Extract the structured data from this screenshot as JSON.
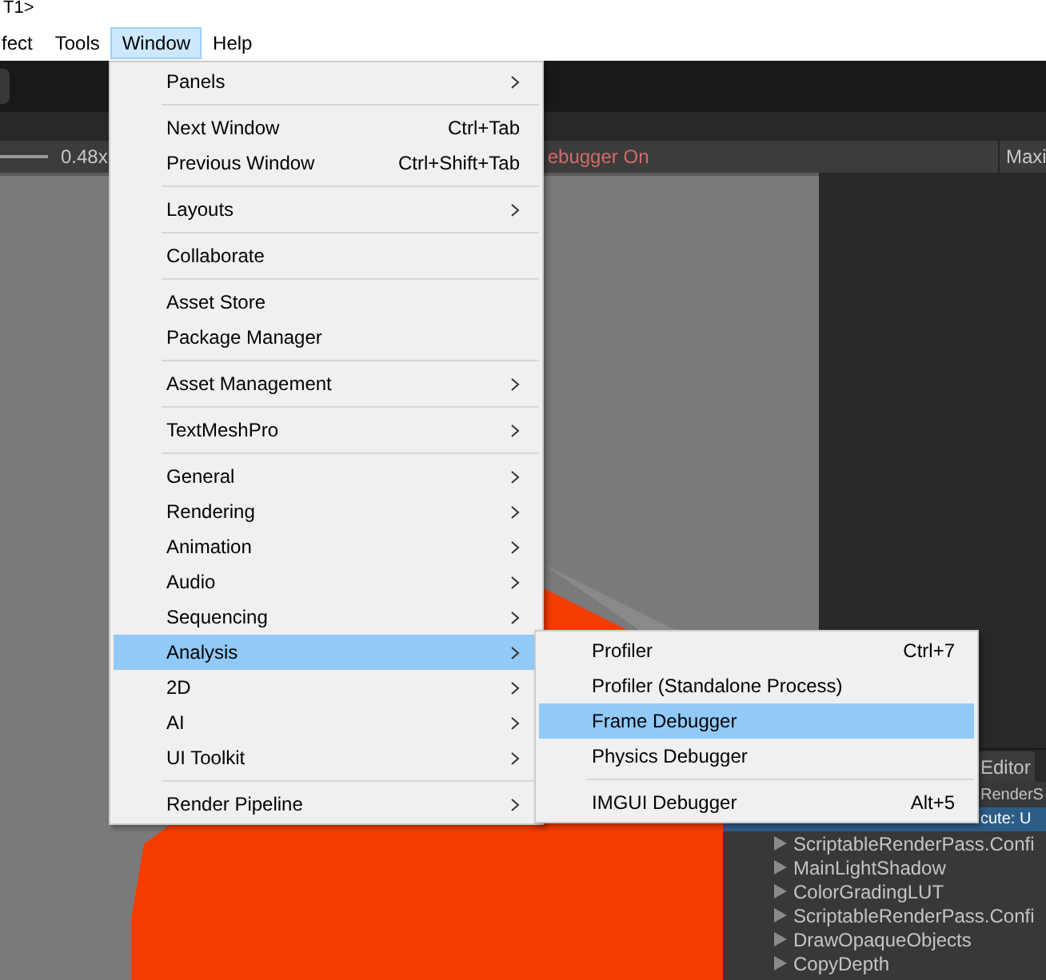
{
  "title_fragment": "T1>",
  "menu_bar": [
    {
      "label": "fect",
      "selected": false
    },
    {
      "label": "Tools",
      "selected": false
    },
    {
      "label": "Window",
      "selected": true
    },
    {
      "label": "Help",
      "selected": false
    }
  ],
  "toolbar": {
    "zoom": "0.48x",
    "status": "ebugger On",
    "button": "Maxi"
  },
  "window_menu": {
    "groups": [
      [
        {
          "label": "Panels",
          "submenu": true,
          "selected": false
        }
      ],
      [
        {
          "label": "Next Window",
          "shortcut": "Ctrl+Tab",
          "submenu": false,
          "selected": false
        },
        {
          "label": "Previous Window",
          "shortcut": "Ctrl+Shift+Tab",
          "submenu": false,
          "selected": false
        }
      ],
      [
        {
          "label": "Layouts",
          "submenu": true,
          "selected": false
        }
      ],
      [
        {
          "label": "Collaborate",
          "submenu": false,
          "selected": false
        }
      ],
      [
        {
          "label": "Asset Store",
          "submenu": false,
          "selected": false
        },
        {
          "label": "Package Manager",
          "submenu": false,
          "selected": false
        }
      ],
      [
        {
          "label": "Asset Management",
          "submenu": true,
          "selected": false
        }
      ],
      [
        {
          "label": "TextMeshPro",
          "submenu": true,
          "selected": false
        }
      ],
      [
        {
          "label": "General",
          "submenu": true,
          "selected": false
        },
        {
          "label": "Rendering",
          "submenu": true,
          "selected": false
        },
        {
          "label": "Animation",
          "submenu": true,
          "selected": false
        },
        {
          "label": "Audio",
          "submenu": true,
          "selected": false
        },
        {
          "label": "Sequencing",
          "submenu": true,
          "selected": false
        },
        {
          "label": "Analysis",
          "submenu": true,
          "selected": true
        },
        {
          "label": "2D",
          "submenu": true,
          "selected": false
        },
        {
          "label": "AI",
          "submenu": true,
          "selected": false
        },
        {
          "label": "UI Toolkit",
          "submenu": true,
          "selected": false
        }
      ],
      [
        {
          "label": "Render Pipeline",
          "submenu": true,
          "selected": false
        }
      ]
    ]
  },
  "analysis_submenu": {
    "groups": [
      [
        {
          "label": "Profiler",
          "shortcut": "Ctrl+7",
          "submenu": false,
          "selected": false
        },
        {
          "label": "Profiler (Standalone Process)",
          "submenu": false,
          "selected": false
        },
        {
          "label": "Frame Debugger",
          "submenu": false,
          "selected": true
        },
        {
          "label": "Physics Debugger",
          "submenu": false,
          "selected": false
        }
      ],
      [
        {
          "label": "IMGUI Debugger",
          "shortcut": "Alt+5",
          "submenu": false,
          "selected": false
        }
      ]
    ]
  },
  "debugger_panel": {
    "tab": "Editor",
    "rows": [
      {
        "kind": "covered",
        "label": "RenderS",
        "selected": false
      },
      {
        "kind": "covered",
        "label": "cute: U",
        "selected": true
      },
      {
        "kind": "node",
        "label": "ScriptableRenderPass.Confi",
        "selected": false
      },
      {
        "kind": "node",
        "label": "MainLightShadow",
        "selected": false
      },
      {
        "kind": "node",
        "label": "ColorGradingLUT",
        "selected": false
      },
      {
        "kind": "node",
        "label": "ScriptableRenderPass.Confi",
        "selected": false
      },
      {
        "kind": "node",
        "label": "DrawOpaqueObjects",
        "selected": false
      },
      {
        "kind": "node",
        "label": "CopyDepth",
        "selected": false
      }
    ]
  }
}
